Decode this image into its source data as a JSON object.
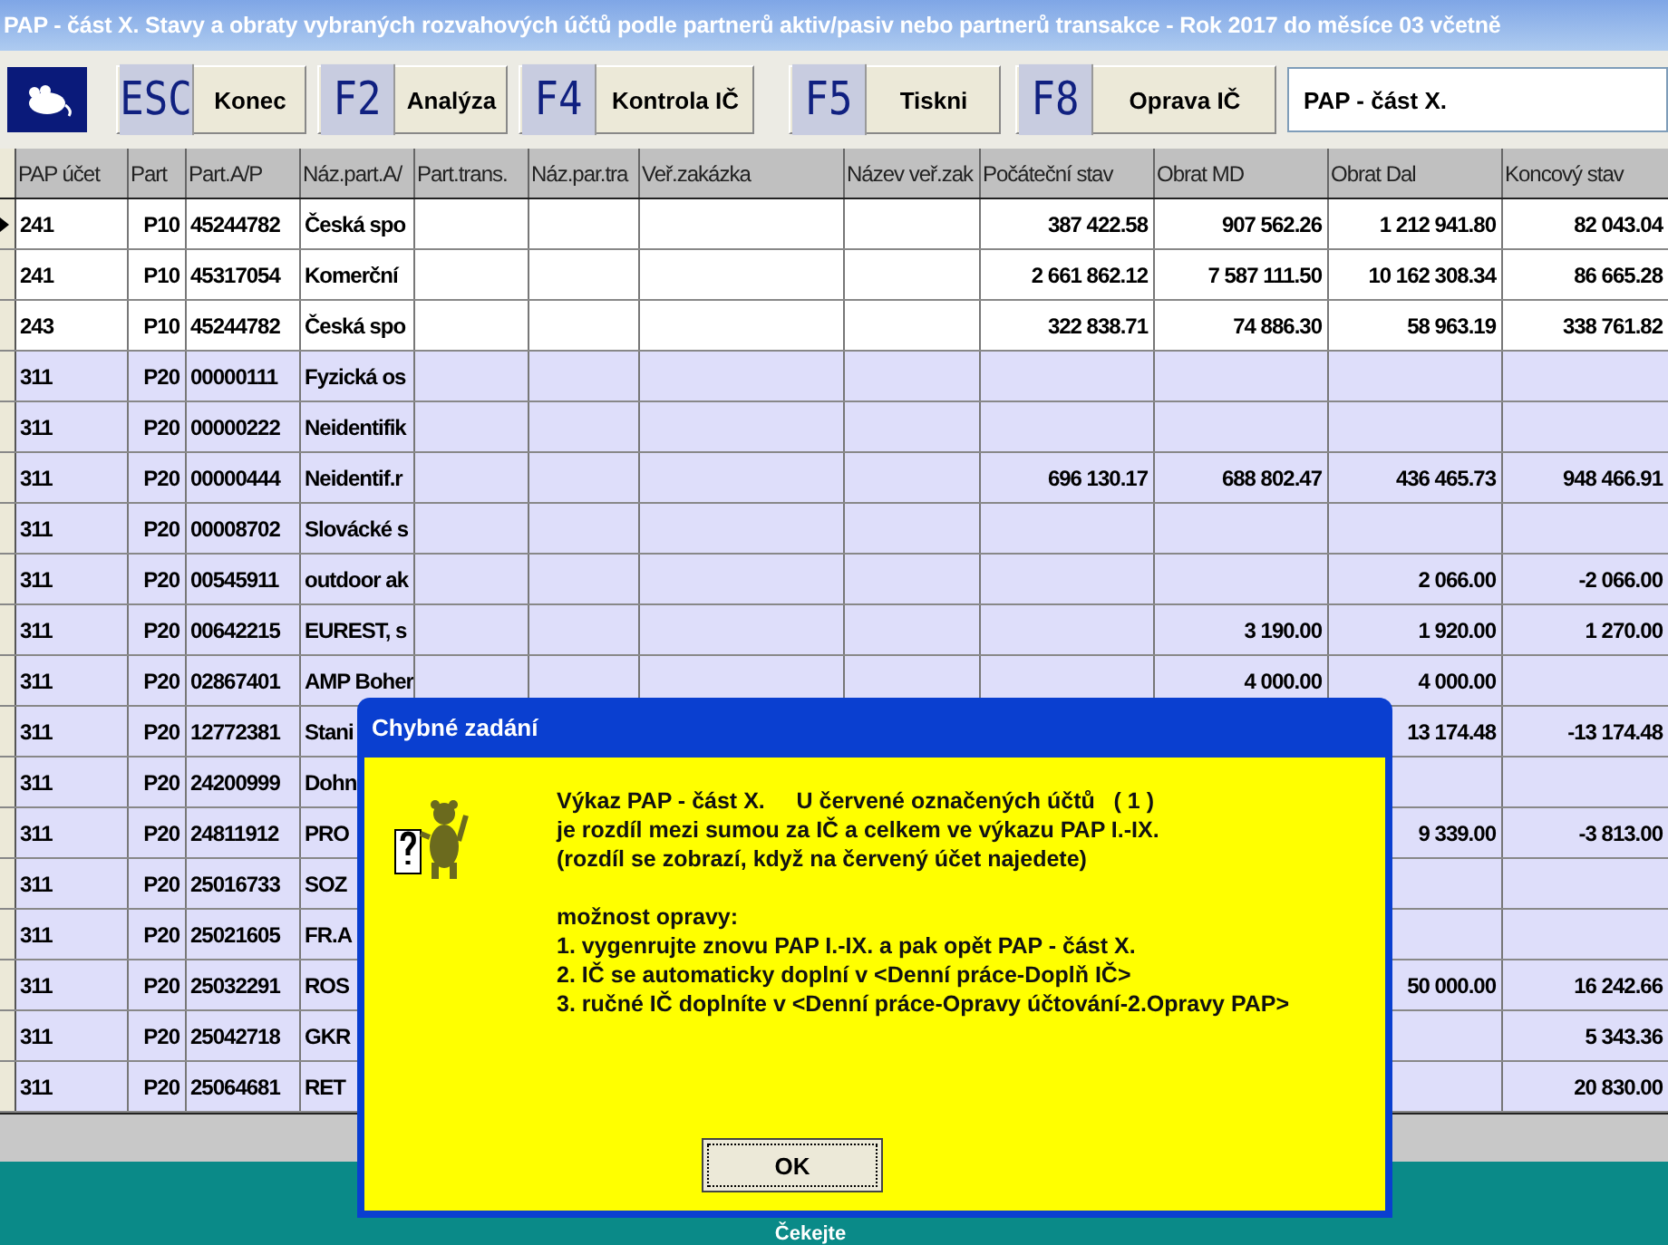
{
  "window": {
    "title": "PAP - část X. Stavy a obraty vybraných rozvahových účtů podle partnerů aktiv/pasiv nebo partnerů transakce - Rok 2017  do měsíce 03  včetně"
  },
  "toolbar": {
    "buttons": [
      {
        "key": "ESC",
        "label": "Konec"
      },
      {
        "key": "F2",
        "label": "Analýza"
      },
      {
        "key": "F4",
        "label": "Kontrola IČ"
      },
      {
        "key": "F5",
        "label": "Tiskni"
      },
      {
        "key": "F8",
        "label": "Oprava IČ"
      }
    ],
    "field_value": "PAP - část X."
  },
  "table": {
    "columns": [
      "PAP účet",
      "Part",
      "Part.A/P",
      "Náz.part.A/",
      "Part.trans.",
      "Náz.par.tra",
      "Veř.zakázka",
      "Název veř.zak",
      "Počáteční stav",
      "Obrat MD",
      "Obrat Dal",
      "Koncový stav"
    ],
    "rows": [
      {
        "selected": true,
        "color": "#ffffff",
        "cells": [
          "241",
          "P10",
          "45244782",
          "Česká spo",
          "",
          "",
          "",
          "",
          "387 422.58",
          "907 562.26",
          "1 212 941.80",
          "82 043.04"
        ]
      },
      {
        "selected": false,
        "color": "#ffffff",
        "cells": [
          "241",
          "P10",
          "45317054",
          "Komerční",
          "",
          "",
          "",
          "",
          "2 661 862.12",
          "7 587 111.50",
          "10 162 308.34",
          "86 665.28"
        ]
      },
      {
        "selected": false,
        "color": "#ffffff",
        "cells": [
          "243",
          "P10",
          "45244782",
          "Česká spo",
          "",
          "",
          "",
          "",
          "322 838.71",
          "74 886.30",
          "58 963.19",
          "338 761.82"
        ]
      },
      {
        "selected": false,
        "color": "#dedefa",
        "cells": [
          "311",
          "P20",
          "00000111",
          "Fyzická os",
          "",
          "",
          "",
          "",
          "",
          "",
          "",
          ""
        ]
      },
      {
        "selected": false,
        "color": "#dedefa",
        "cells": [
          "311",
          "P20",
          "00000222",
          "Neidentifik",
          "",
          "",
          "",
          "",
          "",
          "",
          "",
          ""
        ]
      },
      {
        "selected": false,
        "color": "#dedefa",
        "cells": [
          "311",
          "P20",
          "00000444",
          "Neidentif.r",
          "",
          "",
          "",
          "",
          "696 130.17",
          "688 802.47",
          "436 465.73",
          "948 466.91"
        ]
      },
      {
        "selected": false,
        "color": "#dedefa",
        "cells": [
          "311",
          "P20",
          "00008702",
          "Slovácké s",
          "",
          "",
          "",
          "",
          "",
          "",
          "",
          ""
        ]
      },
      {
        "selected": false,
        "color": "#dedefa",
        "cells": [
          "311",
          "P20",
          "00545911",
          "outdoor ak",
          "",
          "",
          "",
          "",
          "",
          "",
          "2 066.00",
          "-2 066.00"
        ]
      },
      {
        "selected": false,
        "color": "#dedefa",
        "cells": [
          "311",
          "P20",
          "00642215",
          "EUREST, s",
          "",
          "",
          "",
          "",
          "",
          "3 190.00",
          "1 920.00",
          "1 270.00"
        ]
      },
      {
        "selected": false,
        "color": "#dedefa",
        "cells": [
          "311",
          "P20",
          "02867401",
          "AMP Boher",
          "",
          "",
          "",
          "",
          "",
          "4 000.00",
          "4 000.00",
          ""
        ]
      },
      {
        "selected": false,
        "color": "#dedefa",
        "cells": [
          "311",
          "P20",
          "12772381",
          "Stani",
          "",
          "",
          "",
          "",
          "",
          "",
          "13 174.48",
          "-13 174.48"
        ]
      },
      {
        "selected": false,
        "color": "#dedefa",
        "cells": [
          "311",
          "P20",
          "24200999",
          "Dohn",
          "",
          "",
          "",
          "",
          "",
          "",
          "",
          ""
        ]
      },
      {
        "selected": false,
        "color": "#dedefa",
        "cells": [
          "311",
          "P20",
          "24811912",
          "PRO",
          "",
          "",
          "",
          "",
          "",
          "",
          "9 339.00",
          "-3 813.00"
        ]
      },
      {
        "selected": false,
        "color": "#dedefa",
        "cells": [
          "311",
          "P20",
          "25016733",
          "SOZ",
          "",
          "",
          "",
          "",
          "",
          "",
          "",
          ""
        ]
      },
      {
        "selected": false,
        "color": "#dedefa",
        "cells": [
          "311",
          "P20",
          "25021605",
          "FR.A",
          "",
          "",
          "",
          "",
          "",
          "",
          "",
          ""
        ]
      },
      {
        "selected": false,
        "color": "#dedefa",
        "cells": [
          "311",
          "P20",
          "25032291",
          "ROS",
          "",
          "",
          "",
          "",
          "",
          "",
          "50 000.00",
          "16 242.66"
        ]
      },
      {
        "selected": false,
        "color": "#dedefa",
        "cells": [
          "311",
          "P20",
          "25042718",
          "GKR",
          "",
          "",
          "",
          "",
          "",
          "",
          "",
          "5 343.36"
        ]
      },
      {
        "selected": false,
        "color": "#dedefa",
        "cells": [
          "311",
          "P20",
          "25064681",
          "RET",
          "",
          "",
          "",
          "",
          "",
          "",
          "",
          "20 830.00"
        ]
      }
    ]
  },
  "dialog": {
    "title": "Chybné zadání",
    "paragraphs": [
      [
        "Výkaz PAP - část X.     U červené označených účtů   ( 1 )",
        "je rozdíl mezi sumou za IČ a celkem ve výkazu PAP I.-IX.",
        "(rozdíl se zobrazí, když na červený účet najedete)"
      ],
      [
        "možnost opravy:",
        "1. vygenrujte znovu PAP I.-IX. a pak opět PAP - část X.",
        "2. IČ se automaticky doplní v <Denní práce-Doplň IČ>",
        "3. ručné IČ doplníte v <Denní práce-Opravy účtování-2.Opravy PAP>"
      ]
    ],
    "button": "OK"
  },
  "status": "Čekejte"
}
